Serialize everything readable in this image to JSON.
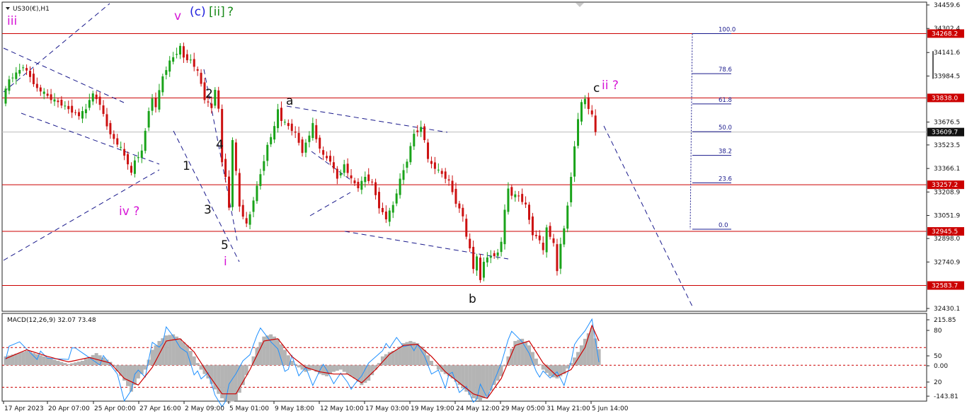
{
  "chart_data": {
    "type": "line",
    "symbol": "US30(€),H1",
    "price_axis": {
      "range": [
        34459.6,
        32430.1
      ],
      "ticks": [
        "34459.6",
        "34302.4",
        "34141.6",
        "33984.5",
        "33676.5",
        "33523.5",
        "33366.1",
        "33208.9",
        "33051.9",
        "32898.0",
        "32740.9",
        "32430.1"
      ]
    },
    "time_axis": {
      "labels": [
        "17 Apr 2023",
        "20 Apr 07:00",
        "25 Apr 00:00",
        "27 Apr 16:00",
        "2 May 09:00",
        "5 May 01:00",
        "9 May 18:00",
        "12 May 10:00",
        "17 May 03:00",
        "19 May 19:00",
        "24 May 12:00",
        "29 May 05:00",
        "31 May 21:00",
        "5 Jun 14:00"
      ]
    },
    "horizontal_levels": [
      {
        "label": "34268.2",
        "price": 34268.2
      },
      {
        "label": "33838.0",
        "price": 33838.0
      },
      {
        "label": "33257.2",
        "price": 33257.2
      },
      {
        "label": "32945.5",
        "price": 32945.5
      },
      {
        "label": "32583.7",
        "price": 32583.7
      }
    ],
    "current_price": {
      "label": "33609.7",
      "price": 33609.7
    },
    "fibonacci": [
      {
        "label": "100.0",
        "price": 34268
      },
      {
        "label": "78.6",
        "price": 34000
      },
      {
        "label": "61.8",
        "price": 33798
      },
      {
        "label": "50.0",
        "price": 33612
      },
      {
        "label": "38.2",
        "price": 33454
      },
      {
        "label": "23.6",
        "price": 33270
      },
      {
        "label": "0.0",
        "price": 32960
      }
    ],
    "price_path": [
      [
        0,
        33820
      ],
      [
        2,
        33960
      ],
      [
        4,
        34000
      ],
      [
        6,
        34050
      ],
      [
        8,
        33980
      ],
      [
        10,
        33900
      ],
      [
        12,
        33870
      ],
      [
        14,
        33830
      ],
      [
        16,
        33810
      ],
      [
        18,
        33780
      ],
      [
        20,
        33750
      ],
      [
        22,
        33720
      ],
      [
        24,
        33760
      ],
      [
        25,
        33830
      ],
      [
        26,
        33860
      ],
      [
        28,
        33800
      ],
      [
        30,
        33650
      ],
      [
        32,
        33560
      ],
      [
        34,
        33500
      ],
      [
        36,
        33400
      ],
      [
        37,
        33330
      ],
      [
        38,
        33420
      ],
      [
        40,
        33480
      ],
      [
        42,
        33760
      ],
      [
        43,
        33830
      ],
      [
        44,
        33780
      ],
      [
        46,
        33980
      ],
      [
        48,
        34080
      ],
      [
        50,
        34140
      ],
      [
        51,
        34180
      ],
      [
        52,
        34110
      ],
      [
        54,
        34090
      ],
      [
        56,
        34010
      ],
      [
        57,
        33930
      ],
      [
        58,
        33830
      ],
      [
        60,
        33770
      ],
      [
        61,
        33900
      ],
      [
        62,
        33760
      ],
      [
        63,
        33410
      ],
      [
        64,
        33320
      ],
      [
        65,
        33100
      ],
      [
        66,
        33560
      ],
      [
        67,
        33340
      ],
      [
        68,
        33110
      ],
      [
        70,
        32990
      ],
      [
        71,
        33060
      ],
      [
        72,
        33160
      ],
      [
        74,
        33330
      ],
      [
        76,
        33520
      ],
      [
        78,
        33640
      ],
      [
        79,
        33760
      ],
      [
        80,
        33690
      ],
      [
        82,
        33650
      ],
      [
        84,
        33600
      ],
      [
        86,
        33480
      ],
      [
        88,
        33590
      ],
      [
        89,
        33660
      ],
      [
        90,
        33560
      ],
      [
        92,
        33450
      ],
      [
        94,
        33420
      ],
      [
        96,
        33300
      ],
      [
        98,
        33390
      ],
      [
        100,
        33290
      ],
      [
        102,
        33240
      ],
      [
        104,
        33310
      ],
      [
        106,
        33270
      ],
      [
        108,
        33110
      ],
      [
        110,
        33030
      ],
      [
        112,
        33120
      ],
      [
        114,
        33290
      ],
      [
        116,
        33420
      ],
      [
        118,
        33600
      ],
      [
        120,
        33640
      ],
      [
        121,
        33560
      ],
      [
        122,
        33420
      ],
      [
        124,
        33370
      ],
      [
        126,
        33330
      ],
      [
        128,
        33280
      ],
      [
        130,
        33140
      ],
      [
        132,
        33050
      ],
      [
        133,
        32900
      ],
      [
        134,
        32830
      ],
      [
        135,
        32700
      ],
      [
        136,
        32770
      ],
      [
        137,
        32620
      ],
      [
        138,
        32750
      ],
      [
        140,
        32780
      ],
      [
        142,
        32800
      ],
      [
        143,
        32880
      ],
      [
        144,
        33080
      ],
      [
        145,
        33230
      ],
      [
        146,
        33190
      ],
      [
        148,
        33180
      ],
      [
        150,
        33120
      ],
      [
        152,
        32930
      ],
      [
        154,
        32890
      ],
      [
        155,
        32810
      ],
      [
        156,
        32970
      ],
      [
        158,
        32860
      ],
      [
        159,
        32680
      ],
      [
        160,
        32870
      ],
      [
        161,
        32960
      ],
      [
        162,
        33120
      ],
      [
        163,
        33320
      ],
      [
        164,
        33510
      ],
      [
        165,
        33700
      ],
      [
        166,
        33800
      ],
      [
        167,
        33830
      ],
      [
        168,
        33770
      ],
      [
        169,
        33720
      ],
      [
        170,
        33610
      ]
    ],
    "macd": {
      "label": "MACD(12,26,9) 32.07 73.48",
      "ticks": [
        "215.85",
        "80",
        "50",
        "0.00",
        "20",
        "-143.81"
      ],
      "levels": [
        80,
        0,
        -100
      ],
      "histogram": [
        [
          0,
          40
        ],
        [
          6,
          65
        ],
        [
          10,
          45
        ],
        [
          14,
          25
        ],
        [
          18,
          5
        ],
        [
          22,
          20
        ],
        [
          26,
          55
        ],
        [
          30,
          15
        ],
        [
          34,
          -70
        ],
        [
          36,
          -120
        ],
        [
          38,
          -60
        ],
        [
          40,
          -20
        ],
        [
          42,
          70
        ],
        [
          44,
          110
        ],
        [
          46,
          135
        ],
        [
          48,
          140
        ],
        [
          50,
          120
        ],
        [
          52,
          90
        ],
        [
          54,
          40
        ],
        [
          56,
          -20
        ],
        [
          58,
          -60
        ],
        [
          60,
          -110
        ],
        [
          62,
          -150
        ],
        [
          64,
          -170
        ],
        [
          66,
          -160
        ],
        [
          68,
          -90
        ],
        [
          70,
          0
        ],
        [
          72,
          80
        ],
        [
          74,
          130
        ],
        [
          76,
          140
        ],
        [
          78,
          120
        ],
        [
          80,
          70
        ],
        [
          82,
          20
        ],
        [
          84,
          -10
        ],
        [
          86,
          -30
        ],
        [
          88,
          -20
        ],
        [
          90,
          -40
        ],
        [
          92,
          -50
        ],
        [
          94,
          -30
        ],
        [
          96,
          -20
        ],
        [
          98,
          -40
        ],
        [
          100,
          -60
        ],
        [
          102,
          -90
        ],
        [
          104,
          -70
        ],
        [
          106,
          -20
        ],
        [
          108,
          40
        ],
        [
          110,
          60
        ],
        [
          112,
          70
        ],
        [
          114,
          100
        ],
        [
          116,
          110
        ],
        [
          118,
          100
        ],
        [
          120,
          70
        ],
        [
          122,
          20
        ],
        [
          124,
          -20
        ],
        [
          126,
          -40
        ],
        [
          128,
          -60
        ],
        [
          130,
          -90
        ],
        [
          132,
          -120
        ],
        [
          134,
          -150
        ],
        [
          136,
          -160
        ],
        [
          138,
          -140
        ],
        [
          140,
          -90
        ],
        [
          142,
          -50
        ],
        [
          144,
          40
        ],
        [
          146,
          110
        ],
        [
          148,
          120
        ],
        [
          150,
          90
        ],
        [
          152,
          30
        ],
        [
          154,
          -20
        ],
        [
          156,
          -50
        ],
        [
          158,
          -60
        ],
        [
          160,
          -40
        ],
        [
          162,
          10
        ],
        [
          164,
          60
        ],
        [
          166,
          120
        ],
        [
          168,
          170
        ],
        [
          170,
          73
        ]
      ],
      "macd_line": [
        [
          0,
          50
        ],
        [
          4,
          100
        ],
        [
          8,
          60
        ],
        [
          12,
          20
        ],
        [
          16,
          40
        ],
        [
          20,
          60
        ],
        [
          24,
          40
        ],
        [
          28,
          20
        ],
        [
          32,
          -40
        ],
        [
          34,
          -150
        ],
        [
          36,
          -90
        ],
        [
          38,
          -40
        ],
        [
          40,
          -60
        ],
        [
          42,
          110
        ],
        [
          44,
          100
        ],
        [
          46,
          150
        ],
        [
          48,
          120
        ],
        [
          50,
          80
        ],
        [
          52,
          70
        ],
        [
          54,
          -20
        ],
        [
          56,
          -80
        ],
        [
          58,
          -40
        ],
        [
          60,
          -130
        ],
        [
          62,
          -170
        ],
        [
          64,
          -110
        ],
        [
          66,
          -50
        ],
        [
          68,
          20
        ],
        [
          70,
          60
        ],
        [
          72,
          160
        ],
        [
          74,
          130
        ],
        [
          76,
          100
        ],
        [
          78,
          80
        ],
        [
          80,
          -10
        ],
        [
          82,
          20
        ],
        [
          84,
          -60
        ],
        [
          86,
          -10
        ],
        [
          88,
          -80
        ],
        [
          90,
          0
        ],
        [
          92,
          -40
        ],
        [
          94,
          -90
        ],
        [
          96,
          -30
        ],
        [
          98,
          -60
        ],
        [
          100,
          -110
        ],
        [
          102,
          -60
        ],
        [
          104,
          10
        ],
        [
          106,
          50
        ],
        [
          108,
          90
        ],
        [
          110,
          60
        ],
        [
          112,
          120
        ],
        [
          114,
          90
        ],
        [
          116,
          110
        ],
        [
          118,
          70
        ],
        [
          120,
          30
        ],
        [
          122,
          -40
        ],
        [
          124,
          -10
        ],
        [
          126,
          -80
        ],
        [
          128,
          -50
        ],
        [
          130,
          -130
        ],
        [
          132,
          -90
        ],
        [
          134,
          -150
        ],
        [
          136,
          -110
        ],
        [
          138,
          -160
        ],
        [
          140,
          -70
        ],
        [
          142,
          20
        ],
        [
          144,
          140
        ],
        [
          146,
          120
        ],
        [
          148,
          100
        ],
        [
          150,
          60
        ],
        [
          152,
          -10
        ],
        [
          154,
          -50
        ],
        [
          156,
          -70
        ],
        [
          158,
          -30
        ],
        [
          160,
          -80
        ],
        [
          162,
          40
        ],
        [
          164,
          100
        ],
        [
          166,
          150
        ],
        [
          168,
          215
        ],
        [
          170,
          32
        ]
      ],
      "signal_line": [
        [
          0,
          30
        ],
        [
          6,
          70
        ],
        [
          12,
          40
        ],
        [
          18,
          15
        ],
        [
          24,
          35
        ],
        [
          30,
          10
        ],
        [
          34,
          -60
        ],
        [
          38,
          -90
        ],
        [
          42,
          -10
        ],
        [
          46,
          110
        ],
        [
          50,
          120
        ],
        [
          54,
          60
        ],
        [
          58,
          -40
        ],
        [
          62,
          -130
        ],
        [
          66,
          -130
        ],
        [
          70,
          -20
        ],
        [
          74,
          110
        ],
        [
          78,
          120
        ],
        [
          82,
          40
        ],
        [
          86,
          -10
        ],
        [
          90,
          -30
        ],
        [
          94,
          -40
        ],
        [
          98,
          -40
        ],
        [
          102,
          -80
        ],
        [
          106,
          -20
        ],
        [
          110,
          50
        ],
        [
          114,
          90
        ],
        [
          118,
          95
        ],
        [
          122,
          40
        ],
        [
          126,
          -30
        ],
        [
          130,
          -80
        ],
        [
          134,
          -130
        ],
        [
          138,
          -150
        ],
        [
          142,
          -60
        ],
        [
          146,
          90
        ],
        [
          150,
          110
        ],
        [
          154,
          10
        ],
        [
          158,
          -50
        ],
        [
          162,
          -20
        ],
        [
          166,
          80
        ],
        [
          168,
          180
        ],
        [
          170,
          110
        ]
      ]
    },
    "wave_labels": [
      {
        "text": "iii",
        "color": "#d616d6"
      },
      {
        "text": "v",
        "color": "#d616d6"
      },
      {
        "text": "(c)",
        "color": "#2222dd"
      },
      {
        "text": "[ii]",
        "color": "#1a8a1a"
      },
      {
        "text": "?",
        "color": "#1a8a1a"
      },
      {
        "text": "iv ?",
        "color": "#d616d6"
      },
      {
        "text": "1",
        "color": "#111111"
      },
      {
        "text": "2",
        "color": "#111111"
      },
      {
        "text": "3",
        "color": "#111111"
      },
      {
        "text": "4",
        "color": "#111111"
      },
      {
        "text": "5",
        "color": "#111111"
      },
      {
        "text": "i",
        "color": "#d616d6"
      },
      {
        "text": "a",
        "color": "#111111"
      },
      {
        "text": "b",
        "color": "#111111"
      },
      {
        "text": "c",
        "color": "#111111"
      },
      {
        "text": "ii ?",
        "color": "#d616d6"
      }
    ],
    "colors": {
      "bull": "#1aa31a",
      "bear": "#cc1111",
      "level": "#cc0000",
      "trend": "#1a1a8c",
      "fib": "#1a1a8c",
      "macd_line": "#1e90ff",
      "signal_line": "#cc0000",
      "histogram": "#b4b4b4"
    }
  }
}
